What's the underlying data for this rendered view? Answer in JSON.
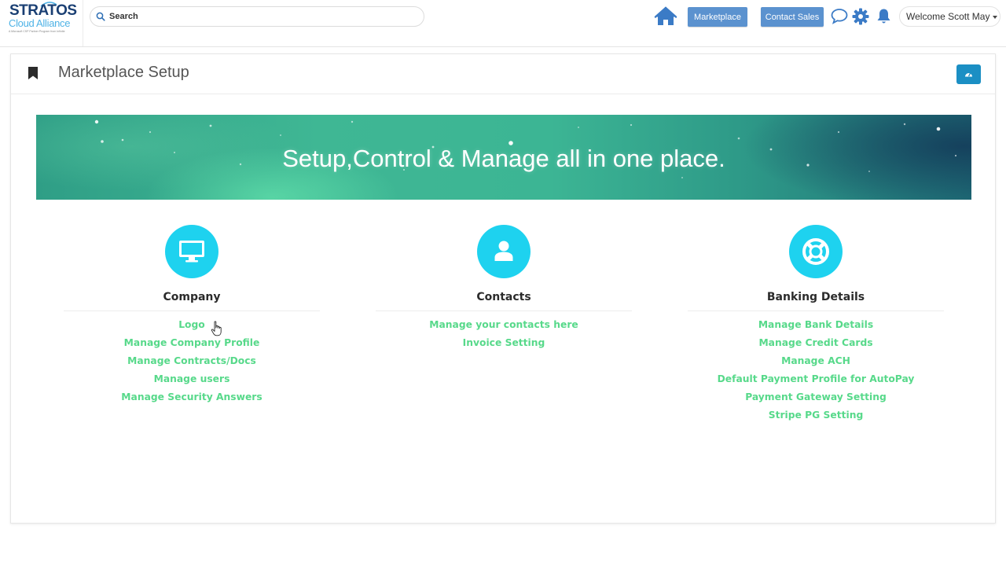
{
  "header": {
    "logo": {
      "name": "STRATOS",
      "subname": "Cloud Alliance",
      "tagline": "A Microsoft CSP Partner Program from Infinite"
    },
    "search": {
      "placeholder": "Search",
      "value": ""
    },
    "buttons": {
      "marketplace": "Marketplace",
      "contact_sales": "Contact Sales"
    },
    "icons": [
      "home-icon",
      "chat-icon",
      "gear-icon",
      "bell-icon"
    ],
    "user_menu": {
      "label": "Welcome Scott May"
    }
  },
  "page": {
    "title": "Marketplace Setup",
    "banner_text": "Setup,Control & Manage all in one place."
  },
  "sections": [
    {
      "title": "Company",
      "icon": "monitor-icon",
      "links": [
        "Logo",
        "Manage Company Profile",
        "Manage Contracts/Docs",
        "Manage users",
        "Manage Security Answers"
      ]
    },
    {
      "title": "Contacts",
      "icon": "user-icon",
      "links": [
        "Manage your contacts here",
        "Invoice Setting"
      ]
    },
    {
      "title": "Banking Details",
      "icon": "lifebuoy-icon",
      "links": [
        "Manage Bank Details",
        "Manage Credit Cards",
        "Manage ACH",
        "Default Payment Profile for AutoPay",
        "Payment Gateway Setting",
        "Stripe PG Setting"
      ]
    }
  ],
  "colors": {
    "accent_blue": "#5b92cf",
    "icon_cyan": "#1ed2ef",
    "link_green": "#57d98a",
    "dashboard_button": "#1b8fc4"
  }
}
